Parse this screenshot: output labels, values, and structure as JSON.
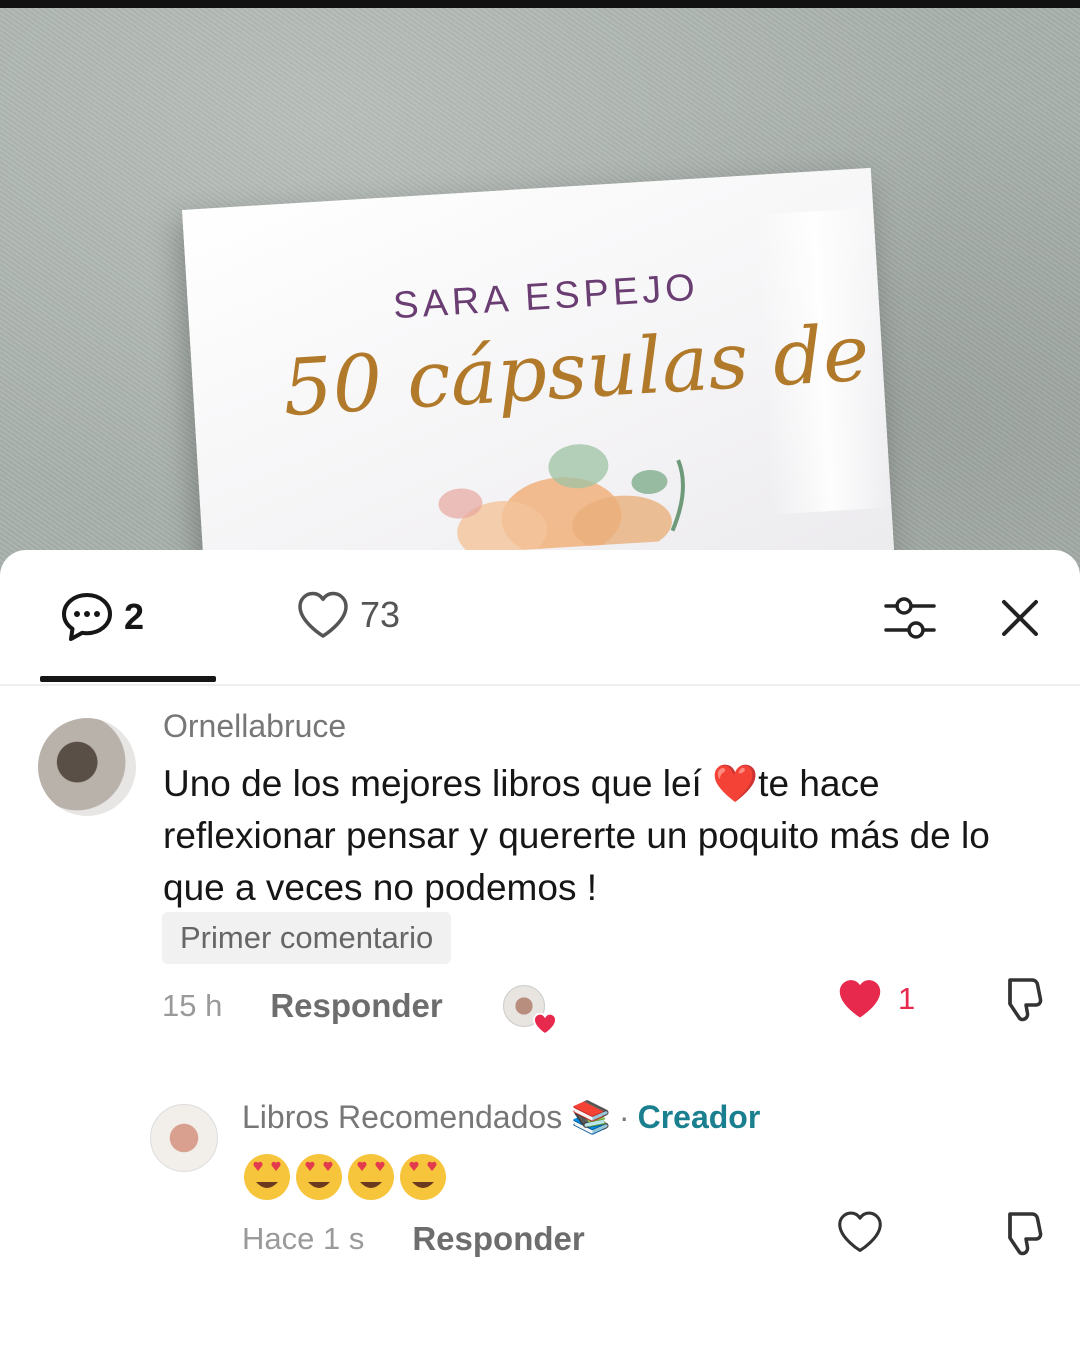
{
  "book": {
    "author": "SARA ESPEJO",
    "title": "50 cápsulas de"
  },
  "tabs": {
    "comments_count": "2",
    "likes_count": "73"
  },
  "icons": {
    "comments_tab": "comment-bubble-icon",
    "likes_tab": "heart-outline-icon",
    "filter": "sliders-icon",
    "close": "close-icon",
    "dislike": "thumbs-down-icon"
  },
  "colors": {
    "like_red": "#e6294c",
    "creator_teal": "#1a7f8e"
  },
  "comments": [
    {
      "username": "Ornellabruce",
      "text": "Uno de los mejores libros que leí ❤️te hace reflexionar pensar y quererte un poquito más de lo que a veces no podemos !",
      "badge": "Primer comentario",
      "time": "15 h",
      "reply_label": "Responder",
      "like_count": "1",
      "liked": true
    },
    {
      "username": "Libros Recomendados 📚",
      "separator": "·",
      "creator_label": "Creador",
      "text": "😍😍😍😍",
      "time": "Hace 1 s",
      "reply_label": "Responder",
      "liked": false
    }
  ]
}
